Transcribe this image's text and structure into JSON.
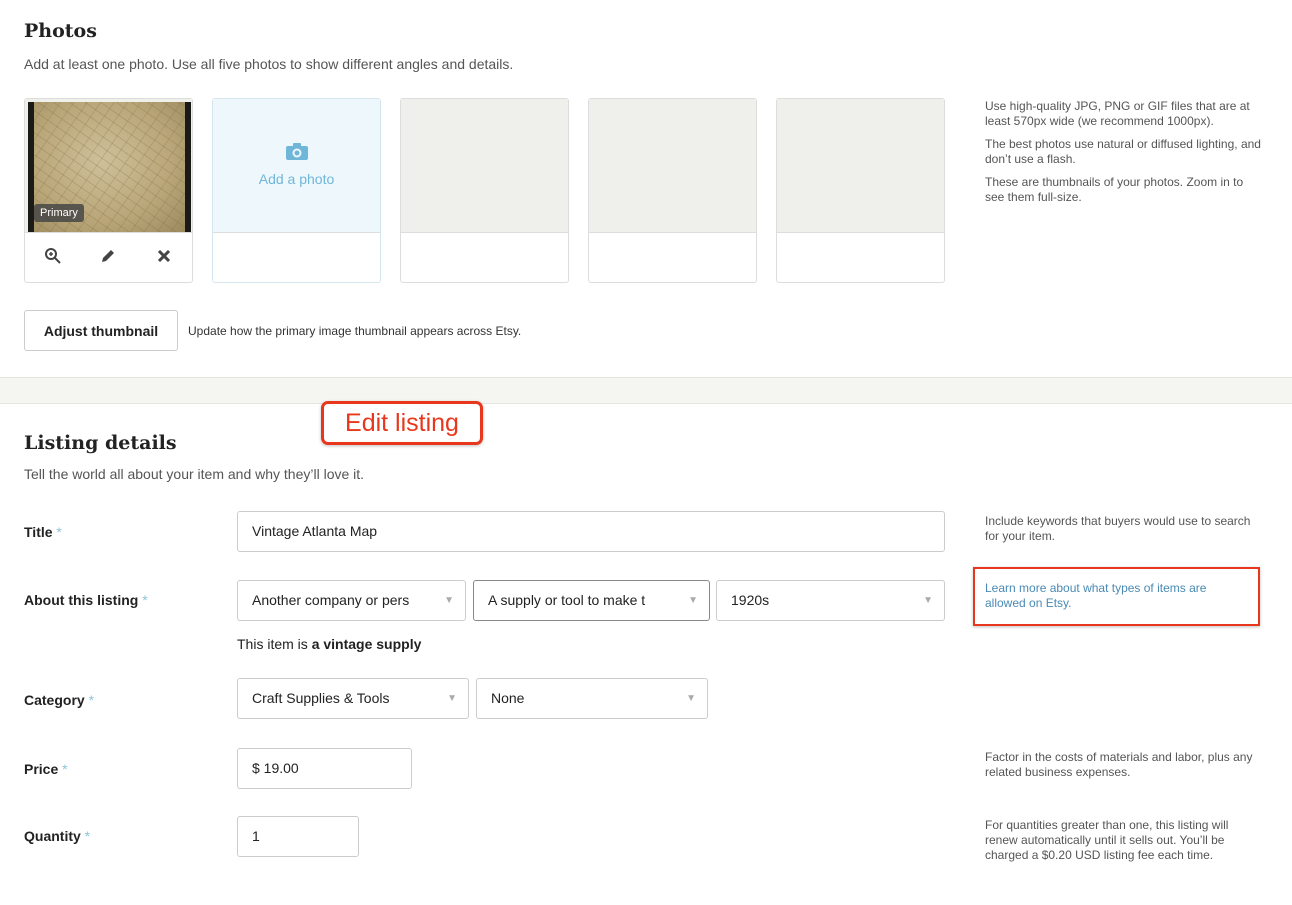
{
  "photos": {
    "title": "Photos",
    "subtitle": "Add at least one photo. Use all five photos to show different angles and details.",
    "primary_badge": "Primary",
    "add_photo_label": "Add a photo",
    "tips": [
      "Use high-quality JPG, PNG or GIF files that are at least 570px wide (we recommend 1000px).",
      "The best photos use natural or diffused lighting, and don’t use a flash.",
      "These are thumbnails of your photos. Zoom in to see them full-size."
    ],
    "adjust_button": "Adjust thumbnail",
    "adjust_note": "Update how the primary image thumbnail appears across Etsy.",
    "icons": [
      "zoom-in-icon",
      "pencil-icon",
      "close-icon",
      "camera-icon"
    ]
  },
  "callout": {
    "label": "Edit listing",
    "color": "#e8371c"
  },
  "details": {
    "title": "Listing details",
    "subtitle": "Tell the world all about your item and why they’ll love it.",
    "required_mark": "*",
    "title_field": {
      "label": "Title",
      "value": "Vintage Atlanta Map",
      "help": "Include keywords that buyers would use to search for your item."
    },
    "about": {
      "label": "About this listing",
      "who_made": "Another company or pers",
      "what_is": "A supply or tool to make t",
      "when_made": "1920s",
      "note_prefix": "This item is ",
      "note_bold": "a vintage supply",
      "learn_more": "Learn more about what types of items are allowed on Etsy."
    },
    "category": {
      "label": "Category",
      "primary": "Craft Supplies & Tools",
      "secondary": "None"
    },
    "price": {
      "label": "Price",
      "value": "$ 19.00",
      "help": "Factor in the costs of materials and labor, plus any related business expenses."
    },
    "quantity": {
      "label": "Quantity",
      "value": "1",
      "help": "For quantities greater than one, this listing will renew automatically until it sells out. You’ll be charged a $0.20 USD listing fee each time."
    }
  },
  "colors": {
    "accent_blue": "#6fb6d9",
    "required_blue": "#8ec3dc",
    "link_blue": "#4a8ab5",
    "callout_red": "#e8371c"
  }
}
